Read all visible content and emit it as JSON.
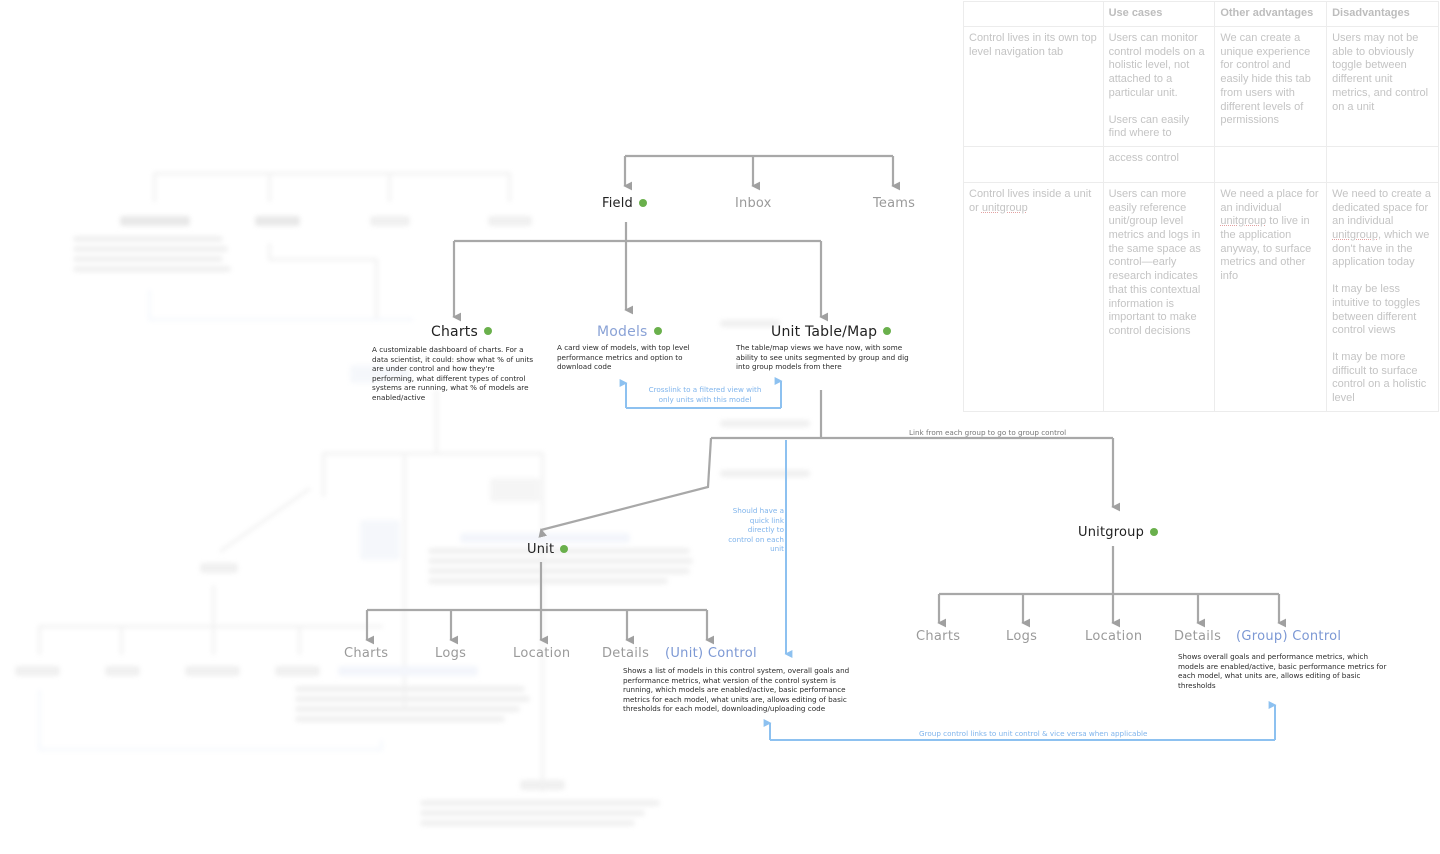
{
  "colors": {
    "status_dot": "#6ab04c",
    "line_gray": "#a8a8a8",
    "link_blue": "#8dc1f0",
    "label_blue": "#7c98d4"
  },
  "nav": {
    "items": [
      {
        "label": "Field",
        "active": true,
        "status": "active"
      },
      {
        "label": "Inbox",
        "active": false
      },
      {
        "label": "Teams",
        "active": false
      }
    ]
  },
  "field_children": [
    {
      "label": "Charts",
      "status": "active",
      "description": "A customizable dashboard of charts. For a data scientist, it could: show what % of units are under control and how they're performing, what different types of control systems are running, what % of models are enabled/active"
    },
    {
      "label": "Models",
      "status": "active",
      "description": "A card view of models, with top level performance metrics and option to download code"
    },
    {
      "label": "Unit Table/Map",
      "status": "active",
      "description": "The table/map views we have now, with some ability to see units segmented by group and dig into group models from there"
    }
  ],
  "annotations": {
    "crosslink": "Crosslink to a filtered view with only units with this model",
    "group_link": "Link from each group to go to group control",
    "quick_link": "Should have a quick link directly to control on each unit",
    "group_unit_link": "Group control links to unit control & vice versa when applicable"
  },
  "unit": {
    "label": "Unit",
    "status": "active",
    "children": [
      "Charts",
      "Logs",
      "Location",
      "Details",
      "(Unit) Control"
    ],
    "control_description": "Shows a list of models in this control system, overall goals and performance metrics, what version of the control system is running, which models are enabled/active, basic performance metrics for each model, what units are, allows editing of basic thresholds for each model, downloading/uploading code"
  },
  "unitgroup": {
    "label": "Unitgroup",
    "status": "active",
    "children": [
      "Charts",
      "Logs",
      "Location",
      "Details",
      "(Group) Control"
    ],
    "control_description": "Shows overall goals and performance metrics, which models are enabled/active, basic performance metrics for each model, what units are, allows editing of basic thresholds"
  },
  "comparison_table": {
    "headers": [
      "",
      "Use cases",
      "Other advantages",
      "Disadvantages"
    ],
    "rows": [
      {
        "option": "Control lives in its own top level navigation tab",
        "use_cases": [
          "Users can monitor control models on a holistic level, not attached to a particular unit.",
          "Users can easily find where to"
        ],
        "other_advantages": [
          "We can create a unique experience for control and easily hide this tab from users with different levels of permissions"
        ],
        "disadvantages": [
          "Users may not be able to obviously toggle between different unit metrics, and control on a unit"
        ]
      },
      {
        "option": "",
        "use_cases": [
          "access control"
        ],
        "other_advantages": [],
        "disadvantages": []
      },
      {
        "option_parts": [
          "Control lives inside a unit or ",
          "unitgroup"
        ],
        "use_cases": [
          "Users can more easily reference unit/group level metrics and logs in the same space as control—early research indicates that this contextual information is important to make control decisions"
        ],
        "other_advantages_parts": [
          "We need a place for an individual ",
          "unitgroup",
          " to live in the application anyway, to surface metrics and other info"
        ],
        "disadvantages_first_parts": [
          "We need to create a dedicated space for an individual ",
          "unitgroup",
          ", which we don't have in the application today"
        ],
        "disadvantages_more": [
          "It may be less intuitive to toggles between different control views",
          "It may be more difficult to surface control on a holistic level"
        ]
      }
    ]
  }
}
